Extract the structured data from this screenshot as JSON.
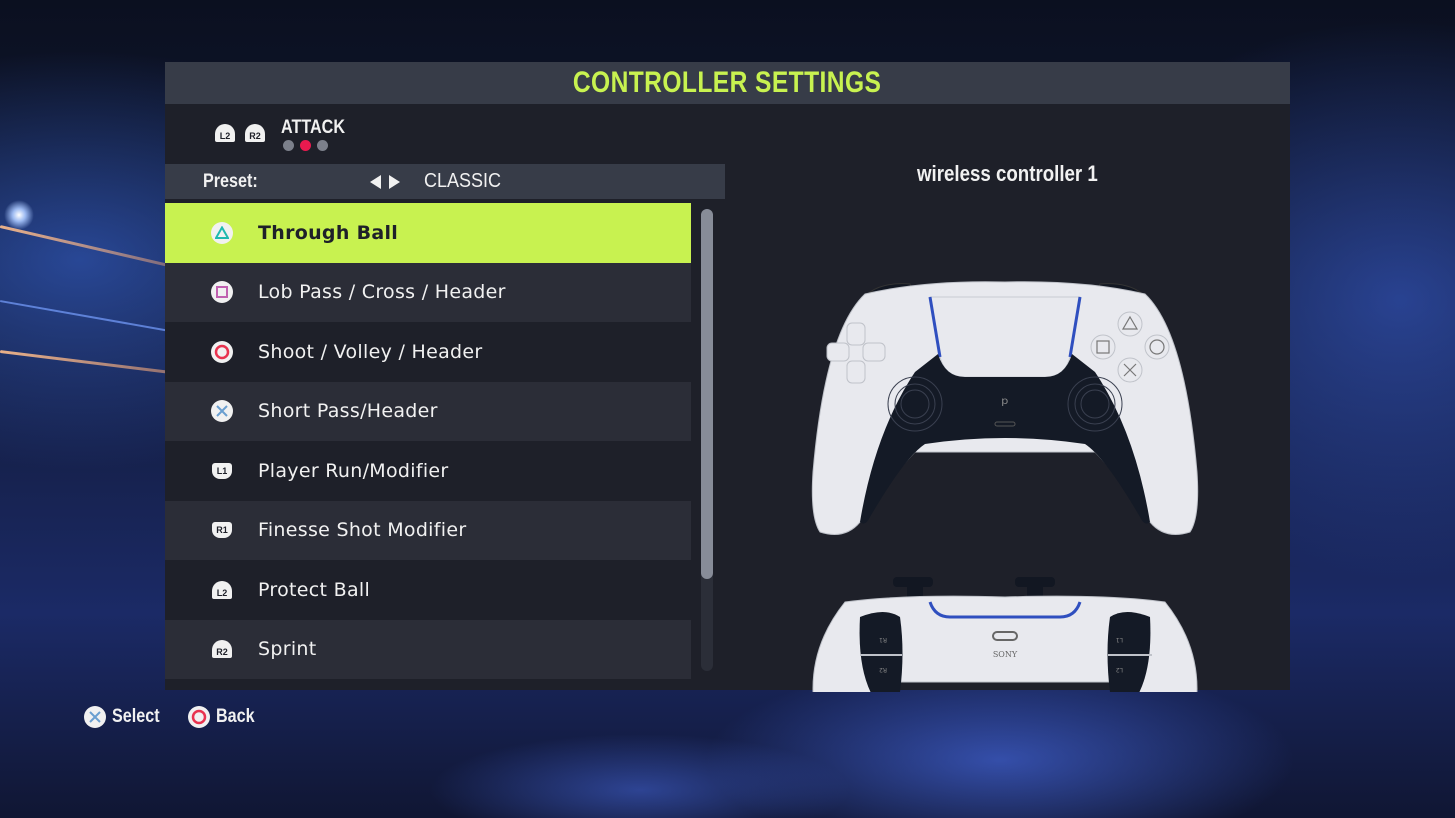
{
  "header": {
    "title": "CONTROLLER SETTINGS"
  },
  "tabs": {
    "prev_trigger": "L2",
    "next_trigger": "R2",
    "current": "ATTACK",
    "page_count": 3,
    "active_page": 2
  },
  "preset": {
    "label": "Preset:",
    "value": "CLASSIC"
  },
  "actions": [
    {
      "button": "triangle",
      "button_label": "△",
      "label": "Through Ball",
      "selected": true
    },
    {
      "button": "square",
      "button_label": "□",
      "label": "Lob Pass / Cross / Header",
      "selected": false
    },
    {
      "button": "circle",
      "button_label": "○",
      "label": "Shoot / Volley / Header",
      "selected": false
    },
    {
      "button": "cross",
      "button_label": "✕",
      "label": "Short Pass/Header",
      "selected": false
    },
    {
      "button": "L1",
      "button_label": "L1",
      "label": "Player Run/Modifier",
      "selected": false
    },
    {
      "button": "R1",
      "button_label": "R1",
      "label": "Finesse Shot Modifier",
      "selected": false
    },
    {
      "button": "L2",
      "button_label": "L2",
      "label": "Protect Ball",
      "selected": false
    },
    {
      "button": "R2",
      "button_label": "R2",
      "label": "Sprint",
      "selected": false
    }
  ],
  "scroll": {
    "visible_fraction": 0.8
  },
  "controller": {
    "name": "wireless controller 1",
    "brand_text": "SONY",
    "back_labels": {
      "r1": "R1",
      "r2": "R2",
      "l1": "L1",
      "l2": "L2"
    }
  },
  "footer": {
    "select_label": "Select",
    "back_label": "Back"
  },
  "colors": {
    "accent": "#c8f250",
    "active_dot": "#ea1a4f",
    "triangle": "#1fb9b0",
    "square": "#c061b0",
    "circle": "#e8334f",
    "cross": "#6a9fd0"
  }
}
